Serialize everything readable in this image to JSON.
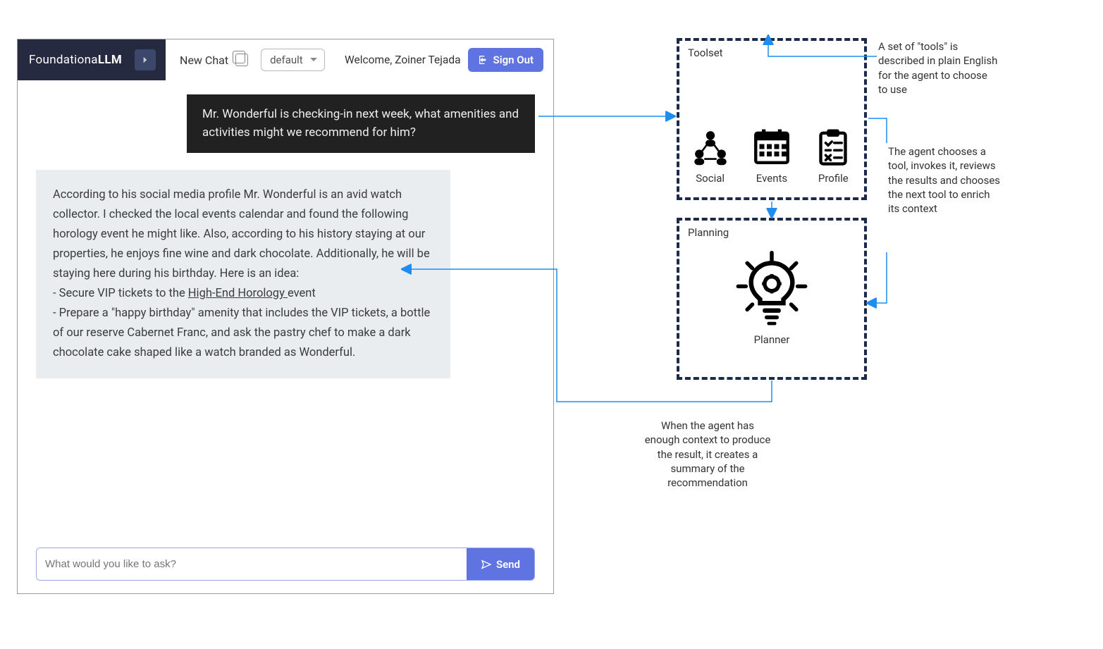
{
  "chat": {
    "brand_prefix": "Foundationa",
    "brand_bold": "LLM",
    "new_chat": "New Chat",
    "dropdown_value": "default",
    "welcome": "Welcome, Zoiner Tejada",
    "signout": "Sign Out",
    "user_message": "Mr. Wonderful is checking-in next week, what amenities and activities might we recommend for him?",
    "assistant_intro": "According to his social media profile Mr. Wonderful is an avid watch collector. I checked the local events calendar and found the following horology event he might like. Also, according to his history staying at our properties, he enjoys fine wine and dark chocolate. Additionally, he will be staying here during his birthday. Here is an idea:",
    "assistant_line1a": "- Secure VIP tickets to the ",
    "assistant_line1b": "High-End Horology ",
    "assistant_line1c": "event",
    "assistant_line2": "- Prepare a \"happy birthday\" amenity that includes the VIP tickets, a bottle of our reserve Cabernet Franc, and ask the pastry chef to make a dark chocolate cake shaped like a watch branded as Wonderful.",
    "input_placeholder": "What would you like to ask?",
    "send": "Send"
  },
  "diagram": {
    "toolset_label": "Toolset",
    "tool_social": "Social",
    "tool_events": "Events",
    "tool_profile": "Profile",
    "planning_label": "Planning",
    "planner": "Planner",
    "caption_tools": "A set of \"tools\" is described in plain English for the agent to choose to use",
    "caption_loop": "The agent chooses a tool, invokes it, reviews the results and chooses the next tool to enrich its context",
    "caption_result": "When the agent has enough context to produce the result, it creates a summary of the recommendation"
  }
}
